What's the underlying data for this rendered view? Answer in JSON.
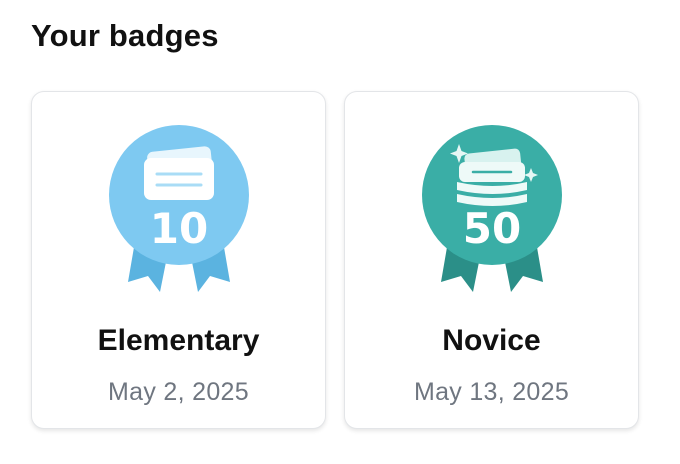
{
  "header": {
    "title": "Your badges"
  },
  "badges": [
    {
      "name": "Elementary",
      "date": "May 2, 2025",
      "count": "10",
      "icon": "flashcard-ribbon-icon",
      "color": "#7ec9f1",
      "ribbon_color": "#5bb3e0"
    },
    {
      "name": "Novice",
      "date": "May 13, 2025",
      "count": "50",
      "icon": "flashcard-stack-ribbon-icon",
      "color": "#3aaea6",
      "ribbon_color": "#2b8f88"
    }
  ]
}
